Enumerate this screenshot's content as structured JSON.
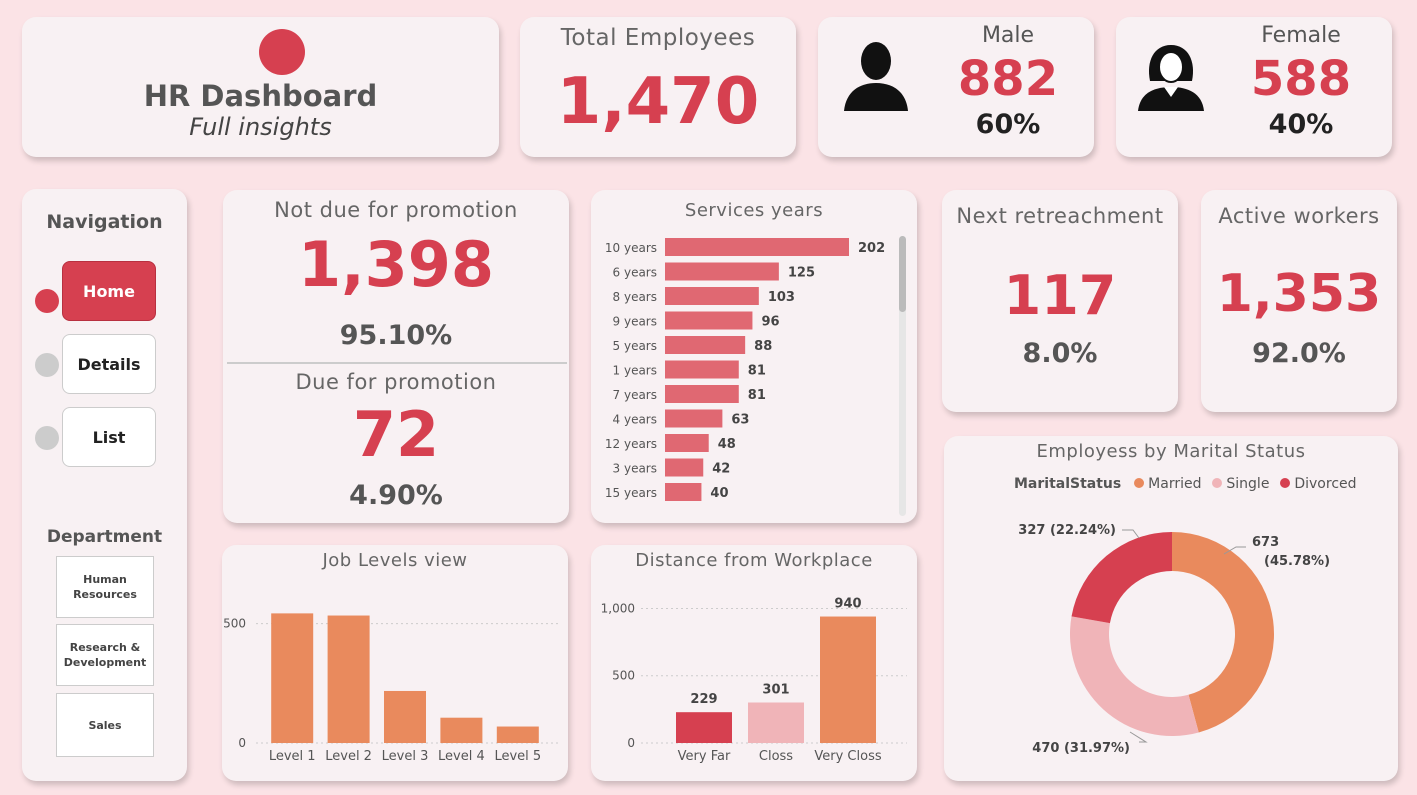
{
  "header": {
    "title": "HR Dashboard",
    "subtitle": "Full insights"
  },
  "total": {
    "label": "Total Employees",
    "value": "1,470"
  },
  "male": {
    "label": "Male",
    "value": "882",
    "pct": "60%",
    "icon": "male-person-icon"
  },
  "female": {
    "label": "Female",
    "value": "588",
    "pct": "40%",
    "icon": "female-person-icon"
  },
  "nav": {
    "title": "Navigation",
    "items": [
      {
        "label": "Home",
        "active": true
      },
      {
        "label": "Details",
        "active": false
      },
      {
        "label": "List",
        "active": false
      }
    ],
    "dept_title": "Department",
    "departments": [
      "Human Resources",
      "Research & Development",
      "Sales"
    ]
  },
  "promotion": {
    "not_due_label": "Not due for promotion",
    "not_due_value": "1,398",
    "not_due_pct": "95.10%",
    "due_label": "Due for promotion",
    "due_value": "72",
    "due_pct": "4.90%"
  },
  "retrenchment": {
    "label": "Next retreachment",
    "value": "117",
    "pct": "8.0%"
  },
  "active": {
    "label": "Active workers",
    "value": "1,353",
    "pct": "92.0%"
  },
  "colors": {
    "accent": "#d64050",
    "orange": "#e98a5d",
    "pink": "#f0b4b8",
    "bar": "#e06872",
    "background": "#fbe3e6"
  },
  "services_chart": {
    "type": "bar",
    "title": "Services years",
    "categories": [
      "10 years",
      "6 years",
      "8 years",
      "9 years",
      "5 years",
      "1 years",
      "7 years",
      "4 years",
      "12 years",
      "3 years",
      "15 years"
    ],
    "values": [
      202,
      125,
      103,
      96,
      88,
      81,
      81,
      63,
      48,
      42,
      40
    ]
  },
  "joblevel_chart": {
    "type": "bar",
    "title": "Job Levels view",
    "categories": [
      "Level 1",
      "Level 2",
      "Level 3",
      "Level 4",
      "Level 5"
    ],
    "values": [
      543,
      534,
      218,
      106,
      69
    ],
    "yticks": [
      "0",
      "500"
    ],
    "ylim": [
      0,
      620
    ]
  },
  "distance_chart": {
    "type": "bar",
    "title": "Distance from Workplace",
    "categories": [
      "Very Far",
      "Closs",
      "Very Closs"
    ],
    "values": [
      229,
      301,
      940
    ],
    "labels": [
      "229",
      "301",
      "940"
    ],
    "yticks": [
      "0",
      "500",
      "1,000"
    ],
    "ylim": [
      0,
      1100
    ]
  },
  "marital_chart": {
    "type": "pie",
    "title": "Employess by Marital Status",
    "legend_title": "MaritalStatus",
    "categories": [
      "Married",
      "Single",
      "Divorced"
    ],
    "values": [
      673,
      470,
      327
    ],
    "labels": [
      "673",
      "(45.78%)",
      "470 (31.97%)",
      "327 (22.24%)"
    ]
  }
}
